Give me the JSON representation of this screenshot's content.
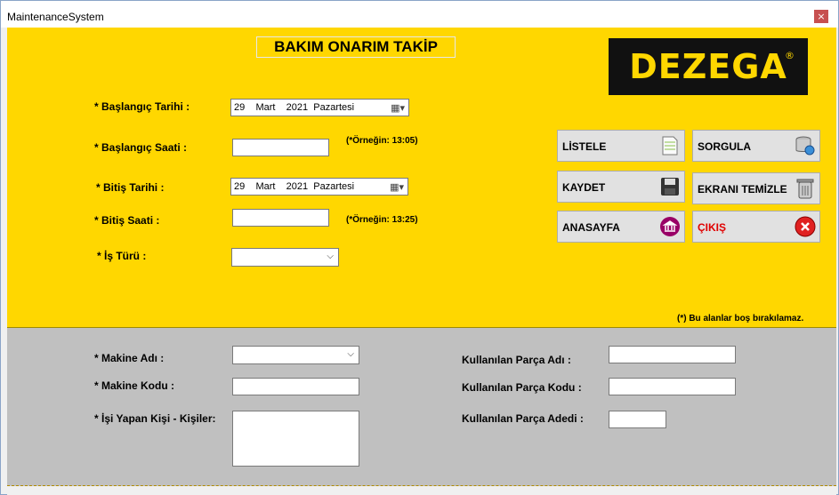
{
  "window": {
    "title": "MaintenanceSystem",
    "close_symbol": "×"
  },
  "header": {
    "title": "BAKIM ONARIM TAKİP"
  },
  "logo": {
    "text": "DEZEGA",
    "registered": "®"
  },
  "form": {
    "start_date_label": "* Başlangıç Tarihi :",
    "start_date_value": "29    Mart    2021  Pazartesi",
    "start_time_label": "* Başlangıç Saati :",
    "start_time_value": "",
    "start_time_hint": "(*Örneğin: 13:05)",
    "end_date_label": "* Bitiş Tarihi :",
    "end_date_value": "29    Mart    2021  Pazartesi",
    "end_time_label": "* Bitiş Saati :",
    "end_time_value": "",
    "end_time_hint": "(*Örneğin: 13:25)",
    "job_type_label": "* İş Türü :",
    "job_type_value": "",
    "required_note": "(*) Bu alanlar boş bırakılamaz."
  },
  "buttons": {
    "list": "LİSTELE",
    "query": "SORGULA",
    "save": "KAYDET",
    "clear": "EKRANI TEMİZLE",
    "home": "ANASAYFA",
    "exit": "ÇIKIŞ"
  },
  "details": {
    "machine_name_label": "* Makine Adı :",
    "machine_code_label": "* Makine Kodu :",
    "workers_label": "* İşi Yapan Kişi - Kişiler:",
    "part_name_label": "Kullanılan Parça Adı :",
    "part_code_label": "Kullanılan Parça Kodu :",
    "part_qty_label": "Kullanılan Parça Adedi :"
  },
  "colors": {
    "form_bg": "#ffd700",
    "lower_bg": "#c0c0c0",
    "exit_text": "#e00000",
    "exit_icon": "#e02020",
    "home_icon": "#990066"
  }
}
